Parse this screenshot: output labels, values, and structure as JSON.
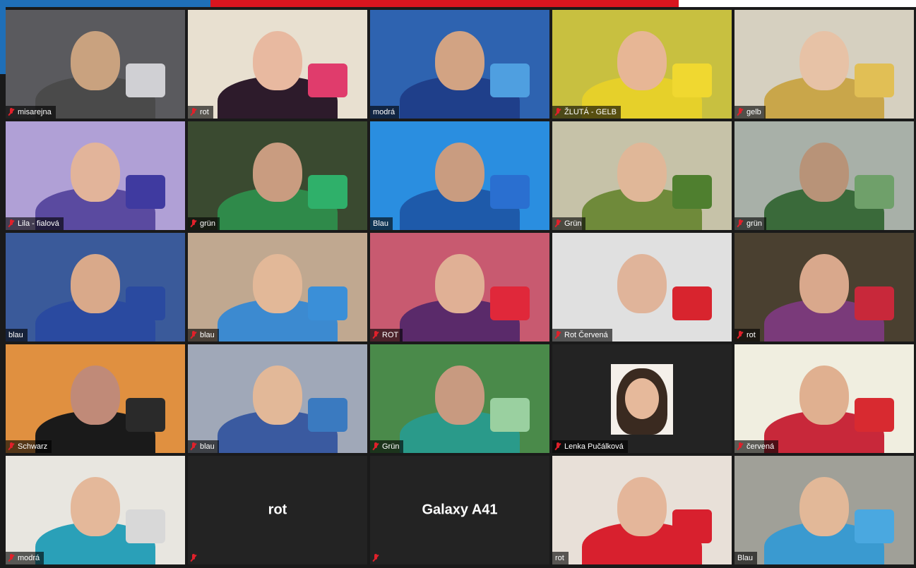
{
  "app": {
    "accent_blue": "#1f6fb8",
    "accent_red": "#d9151f"
  },
  "participants": [
    {
      "name": "misarejna",
      "muted": true,
      "bg": "#5a5a5e",
      "skin": "#c9a27f",
      "shirt": "#4a4a4a",
      "prop": "#d0d0d4"
    },
    {
      "name": "rot",
      "muted": true,
      "bg": "#e8e0d0",
      "skin": "#e8b9a0",
      "shirt": "#2d1b2b",
      "prop": "#e03c6c"
    },
    {
      "name": "modrá",
      "muted": false,
      "bg": "#2e63b0",
      "skin": "#d2a383",
      "shirt": "#1f3f8a",
      "prop": "#4f9fe0"
    },
    {
      "name": "ŽLUTÁ - GELB",
      "muted": true,
      "bg": "#c8c040",
      "skin": "#e7b695",
      "shirt": "#e6d02a",
      "prop": "#f0d830"
    },
    {
      "name": "gelb",
      "muted": true,
      "bg": "#d6d0c0",
      "skin": "#e7c2a6",
      "shirt": "#c9a64a",
      "prop": "#e1bf55"
    },
    {
      "name": "Lila - fialová",
      "muted": true,
      "bg": "#b0a0d6",
      "skin": "#e2b49a",
      "shirt": "#5a4aa0",
      "prop": "#3f3aa0"
    },
    {
      "name": "grün",
      "muted": true,
      "bg": "#3a4a30",
      "skin": "#c99c80",
      "shirt": "#2f8a4a",
      "prop": "#2fb06a"
    },
    {
      "name": "Blau",
      "muted": false,
      "bg": "#2a8ee0",
      "skin": "#c99c80",
      "shirt": "#1e5aaa",
      "prop": "#2a6fd0"
    },
    {
      "name": "Grün",
      "muted": true,
      "bg": "#c6c2a8",
      "skin": "#e0b798",
      "shirt": "#6f8a3a",
      "prop": "#4f7f2f"
    },
    {
      "name": "grün",
      "muted": true,
      "bg": "#a8b0a8",
      "skin": "#b89378",
      "shirt": "#3a6a3a",
      "prop": "#6fa06a"
    },
    {
      "name": "blau",
      "muted": false,
      "bg": "#3a5a9a",
      "skin": "#d9a98a",
      "shirt": "#2a4aa0",
      "prop": "#2a4aa0"
    },
    {
      "name": "blau",
      "muted": true,
      "bg": "#c0a890",
      "skin": "#e2b898",
      "shirt": "#3c8ad0",
      "prop": "#3a8fd8"
    },
    {
      "name": "ROT",
      "muted": true,
      "bg": "#c85a70",
      "skin": "#e0b095",
      "shirt": "#5a2a6a",
      "prop": "#e0283a"
    },
    {
      "name": "Rot Červená",
      "muted": true,
      "bg": "#e0e0e0",
      "skin": "#e0b49a",
      "shirt": "#e0e0e0",
      "prop": "#d8242e"
    },
    {
      "name": "rot",
      "muted": true,
      "bg": "#4a4030",
      "skin": "#d9a88c",
      "shirt": "#7a3a7a",
      "prop": "#c8283a"
    },
    {
      "name": "Schwarz",
      "muted": true,
      "bg": "#e09040",
      "skin": "#c08a78",
      "shirt": "#1a1a1a",
      "prop": "#2a2a2a"
    },
    {
      "name": "blau",
      "muted": true,
      "bg": "#a0a8b8",
      "skin": "#e2b898",
      "shirt": "#3a5aa0",
      "prop": "#3a7ac0"
    },
    {
      "name": "Grün",
      "muted": true,
      "bg": "#4a8a4a",
      "skin": "#c89a80",
      "shirt": "#2a9a8a",
      "prop": "#9ad0a0"
    },
    {
      "name": "Lenka Pučálková",
      "muted": true,
      "bg": "#232323",
      "skin": "#e6b99b",
      "shirt": "#3a2a20",
      "prop": "#232323",
      "avatar_only": true
    },
    {
      "name": "červená",
      "muted": true,
      "bg": "#f0eee0",
      "skin": "#e0b090",
      "shirt": "#c8283a",
      "prop": "#d82a30"
    },
    {
      "name": "modrá",
      "muted": true,
      "bg": "#e8e6e0",
      "skin": "#e4b89a",
      "shirt": "#2aa0b8",
      "prop": "#d8d8d8"
    },
    {
      "name": "rot",
      "muted": true,
      "blank": true,
      "display": "rot"
    },
    {
      "name": "Galaxy A41",
      "muted": true,
      "blank": true,
      "display": "Galaxy A41"
    },
    {
      "name": "rot",
      "muted": false,
      "bg": "#e8e0d8",
      "skin": "#e4b69a",
      "shirt": "#d8202e",
      "prop": "#d8202e"
    },
    {
      "name": "Blau",
      "muted": false,
      "bg": "#a0a098",
      "skin": "#e2b898",
      "shirt": "#3a9ad0",
      "prop": "#4aa8e0"
    }
  ]
}
